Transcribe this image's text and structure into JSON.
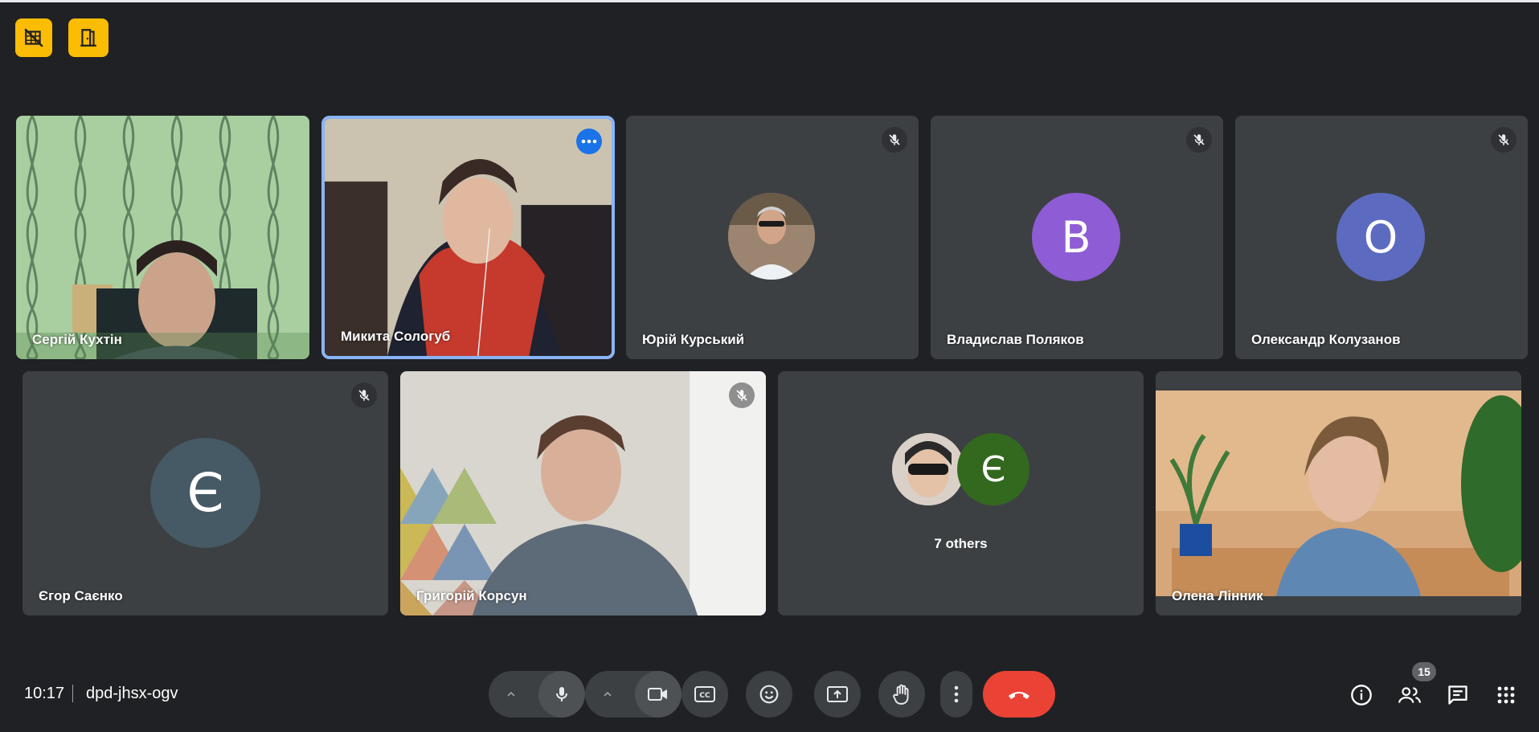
{
  "meeting": {
    "time": "10:17",
    "code": "dpd-jhsx-ogv"
  },
  "colors": {
    "accent_yellow": "#fbbc04",
    "tile_bg": "#3c4043",
    "active_border": "#8ab4f8",
    "end_call": "#ea4335"
  },
  "top_buttons": [
    {
      "icon": "camera-off-grid-icon"
    },
    {
      "icon": "door-exit-icon"
    }
  ],
  "participants": [
    {
      "name": "Сергій Кухтін",
      "video": true
    },
    {
      "name": "Микита Сологуб",
      "video": true,
      "active": true
    },
    {
      "name": "Юрій Курський",
      "video": false,
      "muted": true,
      "avatar": "photo"
    },
    {
      "name": "Владислав Поляков",
      "video": false,
      "muted": true,
      "initial": "В",
      "color": "#8e5cd4"
    },
    {
      "name": "Олександр Колузанов",
      "video": false,
      "muted": true,
      "initial": "О",
      "color": "#5c6bc0"
    },
    {
      "name": "Єгор Саєнко",
      "video": false,
      "muted": true,
      "initial": "Є",
      "color": "#455a64"
    },
    {
      "name": "Григорій Корсун",
      "video": true,
      "muted": true
    },
    {
      "name": "Олена Лінник",
      "video": true
    }
  ],
  "others": {
    "label": "7 others",
    "initial": "Є",
    "color": "#33691e"
  },
  "participant_count": "15",
  "controls": [
    "mic-icon",
    "camera-icon",
    "captions-icon",
    "emoji-icon",
    "present-icon",
    "raise-hand-icon",
    "more-options-icon",
    "end-call-icon"
  ],
  "right_controls": [
    "info-icon",
    "people-icon",
    "chat-icon",
    "apps-icon"
  ]
}
